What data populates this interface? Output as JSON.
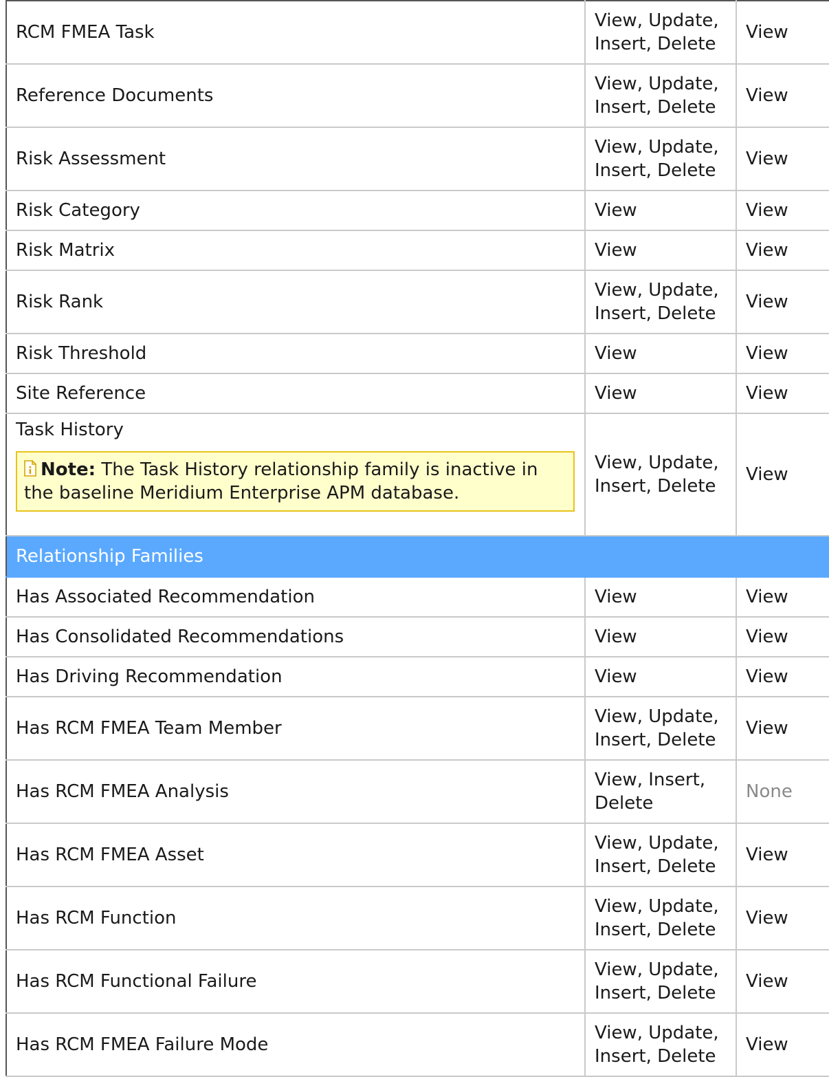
{
  "rows_top": [
    {
      "name": "RCM FMEA Task",
      "privilege1": "View, Update, Insert, Delete",
      "privilege2": "View"
    },
    {
      "name": "Reference Documents",
      "privilege1": "View, Update, Insert, Delete",
      "privilege2": "View"
    },
    {
      "name": "Risk Assessment",
      "privilege1": "View, Update, Insert, Delete",
      "privilege2": "View"
    },
    {
      "name": "Risk Category",
      "privilege1": "View",
      "privilege2": "View"
    },
    {
      "name": "Risk Matrix",
      "privilege1": "View",
      "privilege2": "View"
    },
    {
      "name": "Risk Rank",
      "privilege1": "View, Update, Insert, Delete",
      "privilege2": "View"
    },
    {
      "name": "Risk Threshold",
      "privilege1": "View",
      "privilege2": "View"
    },
    {
      "name": "Site Reference",
      "privilege1": "View",
      "privilege2": "View"
    },
    {
      "name": "Task History",
      "privilege1": "View, Update, Insert, Delete",
      "privilege2": "View"
    }
  ],
  "note": {
    "label": "Note:",
    "text": " The Task History relationship family is inactive in the baseline Meridium Enterprise APM database.",
    "icon": "info-note-icon"
  },
  "section_header": "Relationship Families",
  "rows_relationship": [
    {
      "name": "Has Associated Recommendation",
      "privilege1": "View",
      "privilege2": "View"
    },
    {
      "name": "Has Consolidated Recommendations",
      "privilege1": "View",
      "privilege2": "View"
    },
    {
      "name": "Has Driving Recommendation",
      "privilege1": "View",
      "privilege2": "View"
    },
    {
      "name": "Has RCM FMEA Team Member",
      "privilege1": "View, Update, Insert, Delete",
      "privilege2": "View"
    },
    {
      "name": "Has RCM FMEA Analysis",
      "privilege1": "View, Insert, Delete",
      "privilege2": "None"
    },
    {
      "name": "Has RCM FMEA Asset",
      "privilege1": "View, Update, Insert, Delete",
      "privilege2": "View"
    },
    {
      "name": "Has RCM Function",
      "privilege1": "View, Update, Insert, Delete",
      "privilege2": "View"
    },
    {
      "name": "Has RCM Functional Failure",
      "privilege1": "View, Update, Insert, Delete",
      "privilege2": "View"
    },
    {
      "name": "Has RCM FMEA Failure Mode",
      "privilege1": "View, Update, Insert, Delete",
      "privilege2": "View"
    }
  ],
  "colors": {
    "section_bg": "#5aa9ff",
    "note_bg": "#ffffcc",
    "note_border": "#e8c31a",
    "muted_text": "#8a8a8a"
  }
}
